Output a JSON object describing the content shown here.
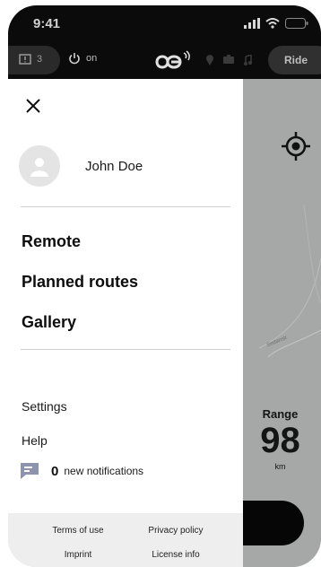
{
  "status_bar": {
    "time": "9:41"
  },
  "header": {
    "messages_count": "3",
    "power_label": "on",
    "ride_label": "Ride"
  },
  "drawer": {
    "user_name": "John Doe",
    "nav": {
      "remote": "Remote",
      "planned_routes": "Planned routes",
      "gallery": "Gallery"
    },
    "links": {
      "settings": "Settings",
      "help": "Help"
    },
    "notifications": {
      "count": "0",
      "label": "new notifications"
    },
    "footer": {
      "terms": "Terms of use",
      "privacy": "Privacy policy",
      "imprint": "Imprint",
      "license": "License info"
    }
  },
  "map": {
    "road_label": "Sedanstr",
    "range_label": "Range",
    "range_value": "98",
    "range_unit": "km"
  },
  "icons": {
    "close": "close-icon",
    "avatar": "user-icon",
    "notification": "chat-icon",
    "locate": "crosshair-icon",
    "power": "power-icon",
    "message": "message-icon"
  },
  "colors": {
    "header_bg": "#0b0b0b",
    "map_bg": "#a6a8a7",
    "notification_icon": "#8e93ad",
    "footer_bg": "#eeeeee"
  }
}
